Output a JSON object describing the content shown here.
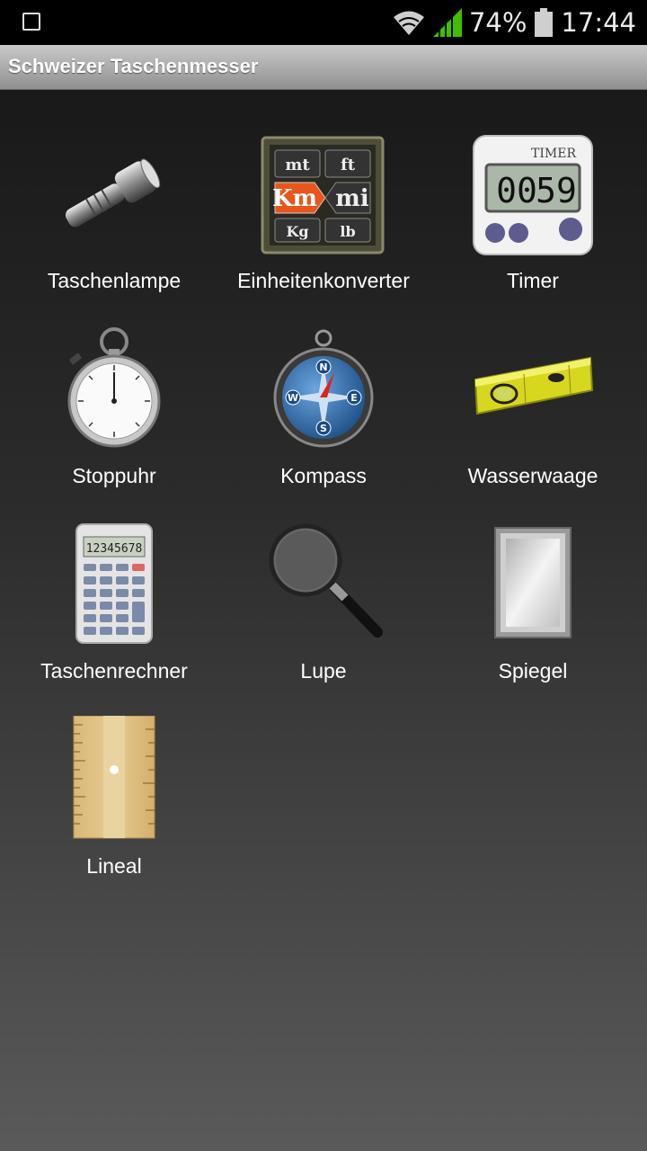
{
  "status_bar": {
    "battery": "74%",
    "time": "17:44",
    "icons": [
      "image-notification-icon",
      "wifi-icon",
      "signal-icon",
      "battery-icon"
    ]
  },
  "app": {
    "title": "Schweizer Taschenmesser"
  },
  "tools": [
    {
      "label": "Taschenlampe",
      "icon": "flashlight-icon"
    },
    {
      "label": "Einheitenkonverter",
      "icon": "unit-converter-icon",
      "icon_text": [
        "mt",
        "ft",
        "Km",
        "mi",
        "Kg",
        "lb"
      ]
    },
    {
      "label": "Timer",
      "icon": "timer-icon",
      "icon_text": [
        "TIMER",
        "00",
        "59"
      ]
    },
    {
      "label": "Stoppuhr",
      "icon": "stopwatch-icon"
    },
    {
      "label": "Kompass",
      "icon": "compass-icon",
      "icon_text": [
        "N",
        "E",
        "S",
        "W"
      ]
    },
    {
      "label": "Wasserwaage",
      "icon": "spirit-level-icon"
    },
    {
      "label": "Taschenrechner",
      "icon": "calculator-icon",
      "icon_text": [
        "12345678"
      ]
    },
    {
      "label": "Lupe",
      "icon": "magnifier-icon"
    },
    {
      "label": "Spiegel",
      "icon": "mirror-icon"
    },
    {
      "label": "Lineal",
      "icon": "ruler-icon"
    }
  ],
  "colors": {
    "status_bar": "#000000",
    "title_bar_top": "#c9c9c9",
    "title_bar_bottom": "#909090",
    "signal_green": "#3fbf00",
    "converter_accent": "#e8561c",
    "level_yellow": "#d7d720"
  }
}
